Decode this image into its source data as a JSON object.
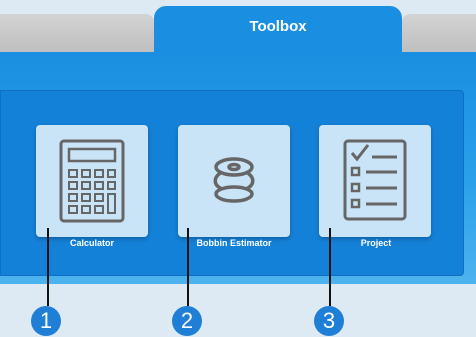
{
  "tabs": {
    "active_label": "Toolbox"
  },
  "tools": [
    {
      "label": "Calculator",
      "icon": "calculator-icon",
      "callout": "1"
    },
    {
      "label": "Bobbin Estimator",
      "icon": "bobbin-icon",
      "callout": "2"
    },
    {
      "label": "Project",
      "icon": "checklist-icon",
      "callout": "3"
    }
  ],
  "colors": {
    "accent": "#1a8ee0",
    "tile_bg": "#c9e4f6",
    "icon_stroke": "#666666",
    "badge": "#1f7fd6"
  }
}
